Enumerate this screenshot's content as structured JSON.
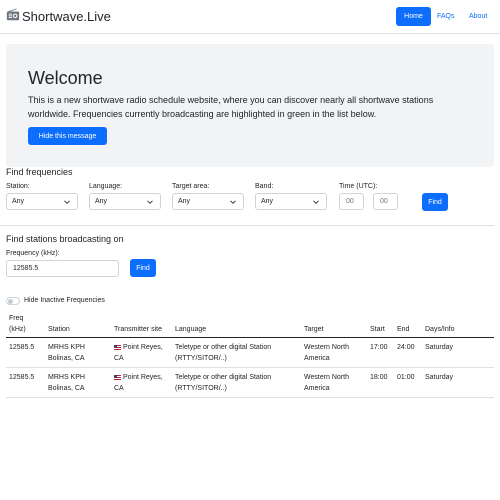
{
  "navbar": {
    "brand": "Shortwave.Live",
    "links": [
      "Home",
      "FAQs",
      "About"
    ]
  },
  "welcome": {
    "title": "Welcome",
    "text": "This is a new shortwave radio schedule website, where you can discover nearly all shortwave stations worldwide. Frequencies currently broadcasting are highlighted in green in the list below.",
    "hide_button": "Hide this message"
  },
  "find_frequencies": {
    "title": "Find frequencies",
    "station_label": "Station:",
    "station_value": "Any",
    "language_label": "Language:",
    "language_value": "Any",
    "target_label": "Target area:",
    "target_value": "Any",
    "band_label": "Band:",
    "band_value": "Any",
    "time_label": "Time (UTC):",
    "time_hour_placeholder": "00",
    "time_minute_placeholder": "00",
    "find_button": "Find"
  },
  "find_stations": {
    "title": "Find stations broadcasting on",
    "freq_label": "Frequency (kHz):",
    "freq_value": "12585.5",
    "find_button": "Find"
  },
  "toggle": {
    "label": "Hide Inactive Frequencies",
    "checked": false
  },
  "table": {
    "headers": {
      "freq": [
        "Freq",
        "(kHz)"
      ],
      "station": "Station",
      "site": "Transmitter site",
      "language": "Language",
      "target": "Target",
      "start": "Start",
      "end": "End",
      "days": "Days/Info"
    },
    "rows": [
      {
        "freq": "12585.5",
        "station": [
          "MRHS KPH",
          "Bolinas, CA"
        ],
        "site": [
          "Point Reyes,",
          "CA"
        ],
        "language": [
          "Teletype or other digital Station",
          "(RTTY/SITOR/..)"
        ],
        "target": [
          "Western North",
          "America"
        ],
        "start": "17:00",
        "end": "24:00",
        "days": "Saturday"
      },
      {
        "freq": "12585.5",
        "station": [
          "MRHS KPH",
          "Bolinas, CA"
        ],
        "site": [
          "Point Reyes,",
          "CA"
        ],
        "language": [
          "Teletype or other digital Station",
          "(RTTY/SITOR/..)"
        ],
        "target": [
          "Western North",
          "America"
        ],
        "start": "18:00",
        "end": "01:00",
        "days": "Saturday"
      }
    ]
  },
  "colors": {
    "primary": "#0d6efd",
    "jumbotron_bg": "#f1f3f5",
    "border": "#dee2e6"
  },
  "icons": {
    "brand": "radio-icon",
    "site_flag": "us-flag-icon",
    "select_chevron": "chevron-down-icon"
  }
}
